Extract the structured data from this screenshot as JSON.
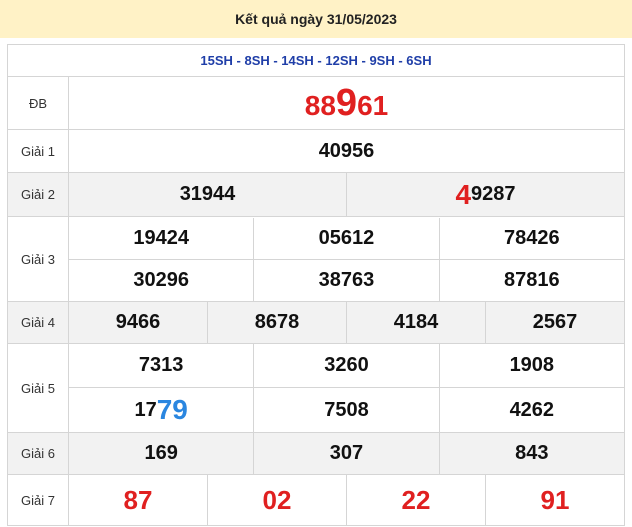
{
  "header": {
    "title": "Kết quả ngày 31/05/2023"
  },
  "codes": "15SH - 8SH - 14SH - 12SH - 9SH - 6SH",
  "labels": {
    "db": "ĐB",
    "g1": "Giải 1",
    "g2": "Giải 2",
    "g3": "Giải 3",
    "g4": "Giải 4",
    "g5": "Giải 5",
    "g6": "Giải 6",
    "g7": "Giải 7"
  },
  "db": {
    "prefix": "88",
    "highlight": "9",
    "suffix": "61"
  },
  "g1": [
    "40956"
  ],
  "g2": [
    {
      "prefix": "",
      "highlight": "",
      "suffix": "31944"
    },
    {
      "prefix": "",
      "highlight": "4",
      "suffix": "9287"
    }
  ],
  "g3": [
    "19424",
    "05612",
    "78426",
    "30296",
    "38763",
    "87816"
  ],
  "g4": [
    "9466",
    "8678",
    "4184",
    "2567"
  ],
  "g5": [
    {
      "prefix": "7313",
      "highlight": ""
    },
    {
      "prefix": "3260",
      "highlight": ""
    },
    {
      "prefix": "1908",
      "highlight": ""
    },
    {
      "prefix": "17",
      "highlight": "79"
    },
    {
      "prefix": "7508",
      "highlight": ""
    },
    {
      "prefix": "4262",
      "highlight": ""
    }
  ],
  "g6": [
    "169",
    "307",
    "843"
  ],
  "g7": [
    "87",
    "02",
    "22",
    "91"
  ],
  "colors": {
    "title_bg": "#fff2c6",
    "codes": "#1f3ea8",
    "red": "#e02020",
    "blue": "#2a86e0"
  }
}
